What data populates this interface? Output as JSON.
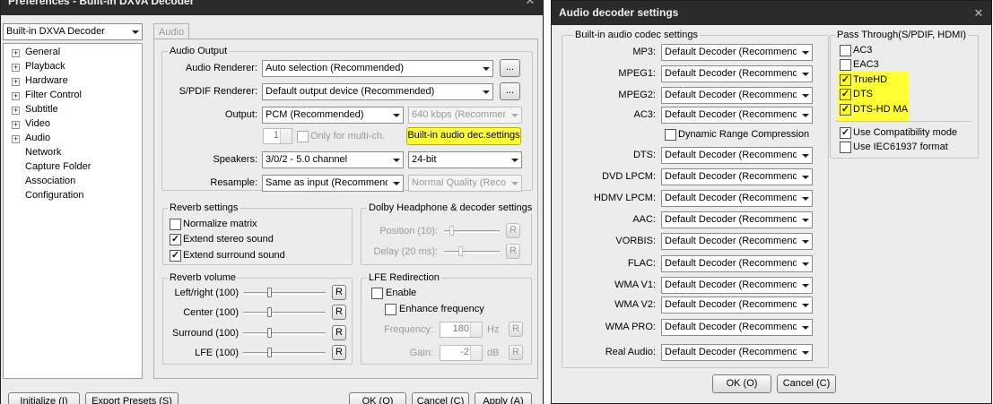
{
  "pref": {
    "title": "Preferences - Built-in DXVA Decoder",
    "decoder_combo": "Built-in DXVA Decoder",
    "tab_audio": "Audio",
    "tree": [
      "General",
      "Playback",
      "Hardware",
      "Filter Control",
      "Subtitle",
      "Video",
      "Audio",
      "Network",
      "Capture Folder",
      "Association",
      "Configuration"
    ],
    "audio_output": {
      "title": "Audio Output",
      "renderer_label": "Audio Renderer:",
      "renderer_value": "Auto selection (Recommended)",
      "spdif_label": "S/PDIF Renderer:",
      "spdif_value": "Default output device (Recommended)",
      "browse": "...",
      "output_label": "Output:",
      "output_value": "PCM (Recommended)",
      "bitrate_value": "640 kbps (Recommen",
      "multich_count": "1",
      "multich_label": "Only for multi-ch.",
      "builtin_btn": "Built-in audio dec.settings",
      "speakers_label": "Speakers:",
      "speakers_value": "3/0/2 - 5.0 channel",
      "bits_value": "24-bit",
      "resample_label": "Resample:",
      "resample_value": "Same as input (Recommende",
      "quality_value": "Normal Quality (Reco"
    },
    "reverb": {
      "title": "Reverb settings",
      "normalize": "Normalize matrix",
      "stereo": "Extend stereo sound",
      "surround": "Extend surround sound"
    },
    "dolby": {
      "title": "Dolby Headphone & decoder settings",
      "position": "Position (10):",
      "delay": "Delay (20 ms):",
      "reset": "R"
    },
    "volume": {
      "title": "Reverb volume",
      "rows": [
        "Left/right (100)",
        "Center (100)",
        "Surround (100)",
        "LFE (100)"
      ],
      "reset": "R"
    },
    "lfe": {
      "title": "LFE Redirection",
      "enable": "Enable",
      "enhance": "Enhance frequency",
      "freq_label": "Frequency:",
      "freq_value": "180",
      "freq_unit": "Hz",
      "gain_label": "Gain:",
      "gain_value": "-2",
      "gain_unit": "dB",
      "reset": "R"
    },
    "buttons": {
      "initialize": "Initialize (I)",
      "export": "Export Presets (S)",
      "ok": "OK (O)",
      "cancel": "Cancel (C)",
      "apply": "Apply (A)"
    }
  },
  "adec": {
    "title": "Audio decoder settings",
    "codec_group": "Built-in audio codec settings",
    "decoder_value": "Default Decoder (Recommende",
    "codecs": [
      "MP3:",
      "MPEG1:",
      "MPEG2:",
      "AC3:",
      "DTS:",
      "DVD LPCM:",
      "HDMV LPCM:",
      "AAC:",
      "VORBIS:",
      "FLAC:",
      "WMA V1:",
      "WMA V2:",
      "WMA PRO:",
      "Real Audio:"
    ],
    "drc": "Dynamic Range Compression (I",
    "passthrough_group": "Pass Through(S/PDIF, HDMI)",
    "pt": [
      {
        "label": "AC3",
        "checked": false,
        "hl": false
      },
      {
        "label": "EAC3",
        "checked": false,
        "hl": false
      },
      {
        "label": "TrueHD",
        "checked": true,
        "hl": true
      },
      {
        "label": "DTS",
        "checked": true,
        "hl": true
      },
      {
        "label": "DTS-HD MA",
        "checked": true,
        "hl": true
      }
    ],
    "compat": "Use Compatibility mode",
    "iec": "Use IEC61937 format",
    "ok": "OK (O)",
    "cancel": "Cancel (C)"
  },
  "colors": {
    "highlight": "#ffff33",
    "titlebar": "#2b2b2b",
    "dialog_bg": "#ececec"
  }
}
